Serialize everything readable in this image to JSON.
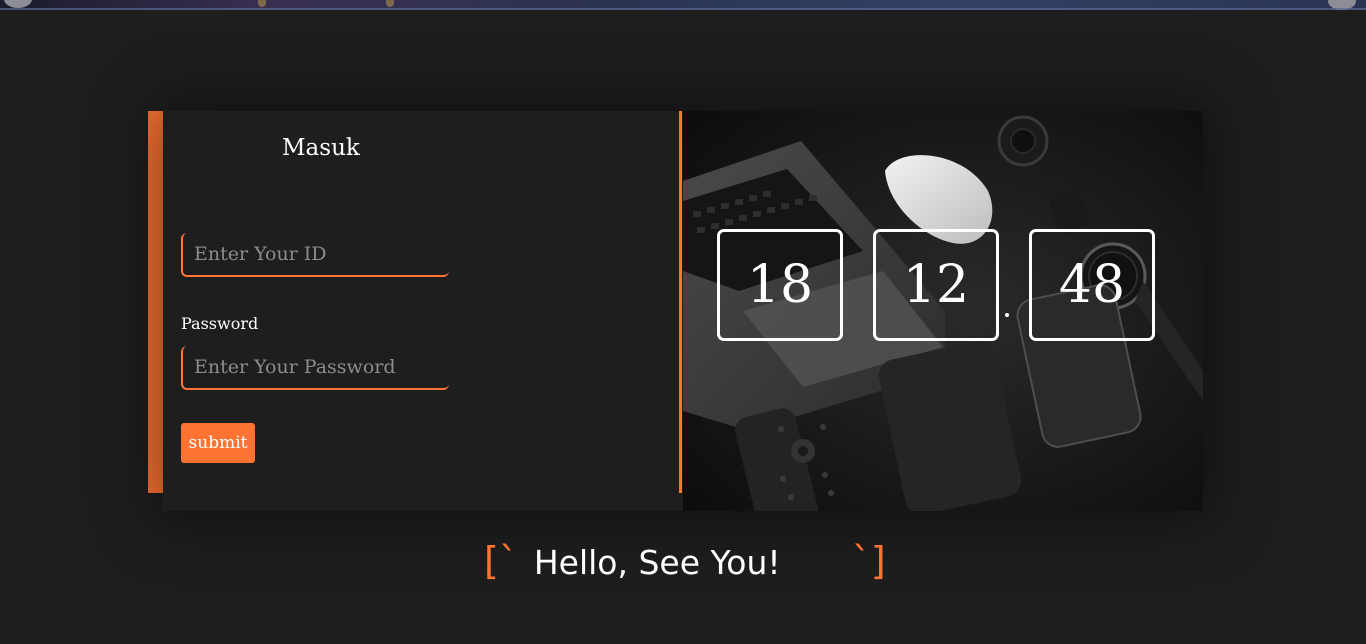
{
  "form": {
    "title": "Masuk",
    "id_placeholder": "Enter Your ID",
    "password_label": "Password",
    "password_placeholder": "Enter Your Password",
    "submit_label": "submit"
  },
  "clock": {
    "hours": "18",
    "minutes": "12",
    "seconds": "48"
  },
  "greeting": {
    "open": "[`",
    "text": "Hello,  See You!",
    "close": "`]"
  },
  "colors": {
    "accent": "#ff7433",
    "background": "#1e1e1e"
  }
}
